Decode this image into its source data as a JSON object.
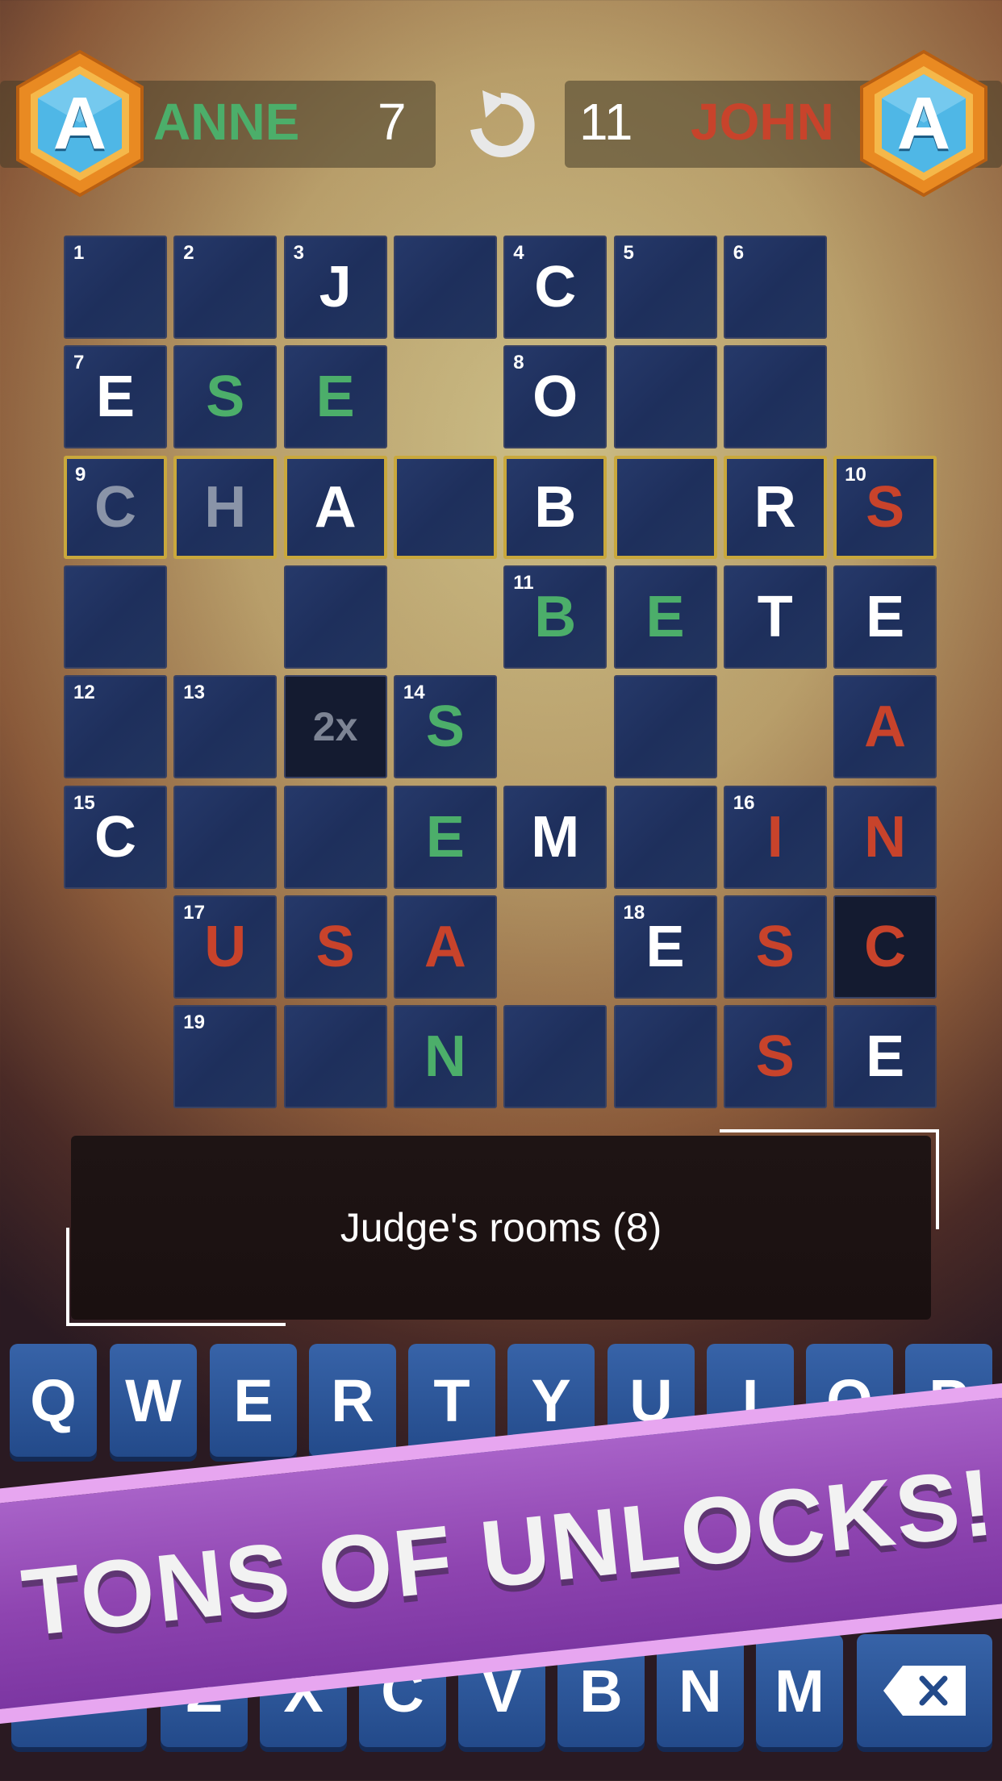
{
  "players": {
    "left": {
      "name": "ANNE",
      "score": "7",
      "avatar_letter": "A",
      "name_color": "#4cae6a"
    },
    "right": {
      "name": "JOHN",
      "score": "11",
      "avatar_letter": "A",
      "name_color": "#c8432b"
    }
  },
  "undo_icon": "undo-arrow-icon",
  "grid": {
    "cells": [
      {
        "id": "r0c0",
        "num": "1",
        "ch": ""
      },
      {
        "id": "r0c1",
        "num": "2",
        "ch": ""
      },
      {
        "id": "r0c2",
        "num": "3",
        "ch": "J",
        "color": "w"
      },
      {
        "id": "r0c3",
        "num": "",
        "ch": ""
      },
      {
        "id": "r0c4",
        "num": "4",
        "ch": "C",
        "color": "w"
      },
      {
        "id": "r0c5",
        "num": "5",
        "ch": ""
      },
      {
        "id": "r0c6",
        "num": "6",
        "ch": ""
      },
      {
        "id": "r1c0",
        "num": "7",
        "ch": "E",
        "color": "w"
      },
      {
        "id": "r1c1",
        "num": "",
        "ch": "S",
        "color": "g"
      },
      {
        "id": "r1c2",
        "num": "",
        "ch": "E",
        "color": "g"
      },
      {
        "id": "r1c4",
        "num": "8",
        "ch": "O",
        "color": "w"
      },
      {
        "id": "r1c5",
        "num": "",
        "ch": ""
      },
      {
        "id": "r1c6",
        "num": "",
        "ch": ""
      },
      {
        "id": "r2c0",
        "num": "9",
        "ch": "C",
        "color": "gray"
      },
      {
        "id": "r2c1",
        "num": "",
        "ch": "H",
        "color": "gray"
      },
      {
        "id": "r2c2",
        "num": "",
        "ch": "A",
        "color": "w"
      },
      {
        "id": "r2c3",
        "num": "",
        "ch": ""
      },
      {
        "id": "r2c4",
        "num": "",
        "ch": "B",
        "color": "w"
      },
      {
        "id": "r2c5",
        "num": "",
        "ch": ""
      },
      {
        "id": "r2c6",
        "num": "",
        "ch": "R",
        "color": "w"
      },
      {
        "id": "r2c7",
        "num": "10",
        "ch": "S",
        "color": "r"
      },
      {
        "id": "r3c0",
        "num": "",
        "ch": ""
      },
      {
        "id": "r3c2",
        "num": "",
        "ch": ""
      },
      {
        "id": "r3c4",
        "num": "11",
        "ch": "B",
        "color": "g"
      },
      {
        "id": "r3c5",
        "num": "",
        "ch": "E",
        "color": "g"
      },
      {
        "id": "r3c6",
        "num": "",
        "ch": "T",
        "color": "w"
      },
      {
        "id": "r3c7",
        "num": "",
        "ch": "E",
        "color": "w"
      },
      {
        "id": "r4c0",
        "num": "12",
        "ch": ""
      },
      {
        "id": "r4c1",
        "num": "13",
        "ch": ""
      },
      {
        "id": "r4c2",
        "num": "",
        "ch": "2x",
        "color": "mult"
      },
      {
        "id": "r4c3",
        "num": "14",
        "ch": "S",
        "color": "g"
      },
      {
        "id": "r4c5",
        "num": "",
        "ch": ""
      },
      {
        "id": "r4c7",
        "num": "",
        "ch": "A",
        "color": "r"
      },
      {
        "id": "r5c0",
        "num": "15",
        "ch": "C",
        "color": "w"
      },
      {
        "id": "r5c1",
        "num": "",
        "ch": ""
      },
      {
        "id": "r5c2",
        "num": "",
        "ch": ""
      },
      {
        "id": "r5c3",
        "num": "",
        "ch": "E",
        "color": "g"
      },
      {
        "id": "r5c4",
        "num": "",
        "ch": "M",
        "color": "w"
      },
      {
        "id": "r5c5",
        "num": "",
        "ch": ""
      },
      {
        "id": "r5c6",
        "num": "16",
        "ch": "I",
        "color": "r"
      },
      {
        "id": "r5c7",
        "num": "",
        "ch": "N",
        "color": "r"
      },
      {
        "id": "r6c1",
        "num": "17",
        "ch": "U",
        "color": "r"
      },
      {
        "id": "r6c2",
        "num": "",
        "ch": "S",
        "color": "r"
      },
      {
        "id": "r6c3",
        "num": "",
        "ch": "A",
        "color": "r"
      },
      {
        "id": "r6c5",
        "num": "18",
        "ch": "E",
        "color": "w"
      },
      {
        "id": "r6c6",
        "num": "",
        "ch": "S",
        "color": "r"
      },
      {
        "id": "r6c7",
        "num": "",
        "ch": "C",
        "color": "r"
      },
      {
        "id": "r7c1",
        "num": "19",
        "ch": ""
      },
      {
        "id": "r7c2",
        "num": "",
        "ch": ""
      },
      {
        "id": "r7c3",
        "num": "",
        "ch": "N",
        "color": "g"
      },
      {
        "id": "r7c4",
        "num": "",
        "ch": ""
      },
      {
        "id": "r7c5",
        "num": "",
        "ch": ""
      },
      {
        "id": "r7c6",
        "num": "",
        "ch": "S",
        "color": "r"
      },
      {
        "id": "r7c7",
        "num": "",
        "ch": "E",
        "color": "w"
      }
    ]
  },
  "clue": {
    "text": "Judge's rooms (8)"
  },
  "keyboard": {
    "row1": [
      "Q",
      "W",
      "E",
      "R",
      "T",
      "Y",
      "U",
      "I",
      "O",
      "P"
    ],
    "row3": [
      "Z",
      "X",
      "C",
      "V",
      "B",
      "N",
      "M"
    ],
    "backspace_icon": "backspace-icon"
  },
  "banner": {
    "text": "TONS OF UNLOCKS!"
  },
  "colors": {
    "cell_bg": "#22355f",
    "highlight_border": "#c9a83c",
    "green_letter": "#4cae6a",
    "red_letter": "#c8432b",
    "banner_purple": "#8e44b0"
  }
}
